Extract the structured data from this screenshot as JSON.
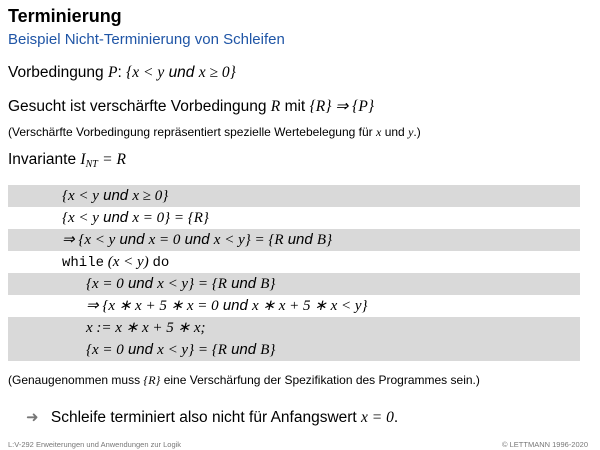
{
  "title": "Terminierung",
  "subtitle": "Beispiel Nicht-Terminierung von Schleifen",
  "line1": {
    "text": "Vorbedingung",
    "P": "P",
    "colon": ":",
    "math": "{x < y",
    "und": "und",
    "math2": "x ≥ 0}"
  },
  "line2": {
    "text": "Gesucht ist verschärfte Vorbedingung",
    "R": "R",
    "mit": "mit",
    "math": "{R} ⇒ {P}"
  },
  "line3": {
    "text": "(Verschärfte Vorbedingung repräsentiert spezielle Wertebelegung für",
    "x": "x",
    "und": "und",
    "y": "y",
    "end": ".)"
  },
  "line4": {
    "text": "Invariante",
    "I": "I",
    "sub": "NT",
    "eq": "= R"
  },
  "rows": {
    "r1": {
      "a": "{x < y",
      "und": "und",
      "b": "x ≥ 0}"
    },
    "r2": {
      "a": "{x < y",
      "und": "und",
      "b": "x = 0} = {R}"
    },
    "r3": {
      "a": "⇒ {x < y",
      "und1": "und",
      "b": "x = 0",
      "und2": "und",
      "c": "x < y} = {R",
      "und3": "und",
      "d": "B}"
    },
    "r4": {
      "kw1": "while",
      "cond": " (x < y) ",
      "kw2": "do"
    },
    "r5": {
      "a": "{x = 0",
      "und1": "und",
      "b": "x < y} = {R",
      "und2": "und",
      "c": "B}"
    },
    "r6": {
      "a": "⇒ {x ∗ x + 5 ∗ x = 0",
      "und": "und",
      "b": "x ∗ x + 5 ∗ x < y}"
    },
    "r7": {
      "a": "x := x ∗ x + 5 ∗ x;"
    },
    "r8": {
      "a": "{x = 0",
      "und1": "und",
      "b": "x < y} = {R",
      "und2": "und",
      "c": "B}"
    }
  },
  "note": {
    "a": "(Genaugenommen muss",
    "R": "{R}",
    "b": "eine Verschärfung der Spezifikation des Programmes sein.)"
  },
  "conclusion": {
    "bullet": "➜",
    "text": "Schleife terminiert also nicht für Anfangswert",
    "math": "x = 0",
    "end": "."
  },
  "footer": {
    "left": "L:V-292   Erweiterungen und Anwendungen zur Logik",
    "right": "© LETTMANN 1996-2020"
  }
}
